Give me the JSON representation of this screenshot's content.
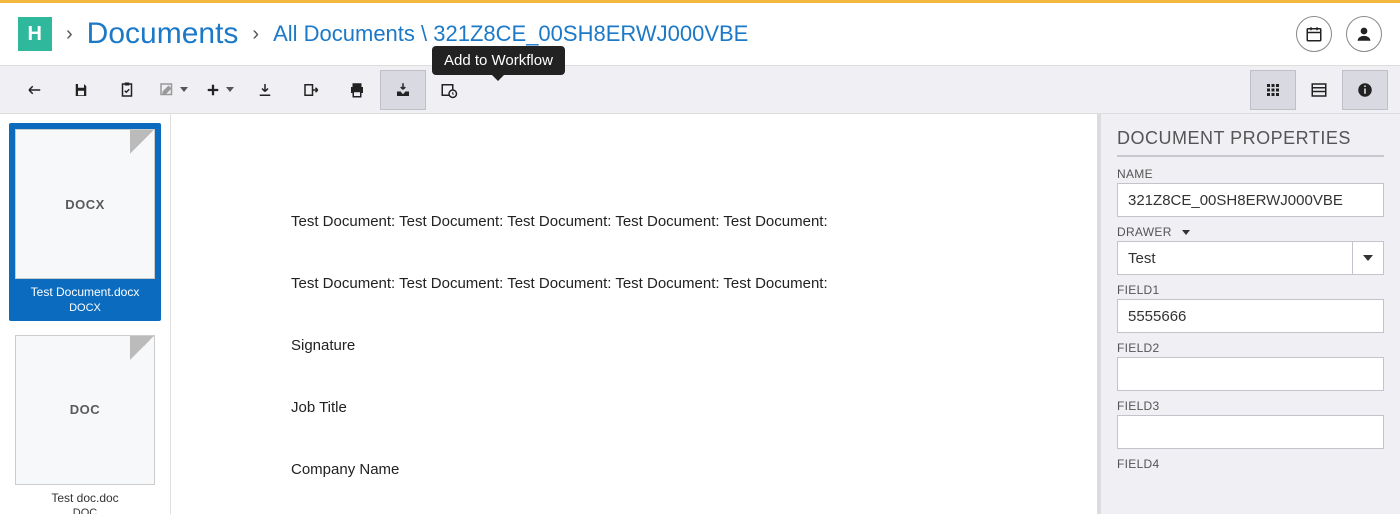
{
  "logo_letter": "H",
  "breadcrumb": {
    "root": "Documents",
    "path_prefix": "All Documents \\ ",
    "doc_id": "321Z8CE_00SH8ERWJ000VBE"
  },
  "tooltip": "Add to Workflow",
  "thumbs": [
    {
      "badge": "DOCX",
      "caption": "Test Document.docx",
      "ext": "DOCX",
      "selected": true
    },
    {
      "badge": "DOC",
      "caption": "Test doc.doc",
      "ext": "DOC",
      "selected": false
    }
  ],
  "document_body": {
    "para1": "Test Document:  Test Document:  Test Document:  Test Document:  Test Document:",
    "para2": "Test Document: Test Document: Test Document: Test Document: Test Document:",
    "sig1": "Signature",
    "sig2": "Job Title",
    "sig3": "Company Name"
  },
  "properties": {
    "title": "DOCUMENT PROPERTIES",
    "name_label": "NAME",
    "name_value": "321Z8CE_00SH8ERWJ000VBE",
    "drawer_label": "DRAWER",
    "drawer_value": "Test",
    "field1_label": "FIELD1",
    "field1_value": "5555666",
    "field2_label": "FIELD2",
    "field2_value": "",
    "field3_label": "FIELD3",
    "field3_value": "",
    "field4_label": "FIELD4"
  }
}
